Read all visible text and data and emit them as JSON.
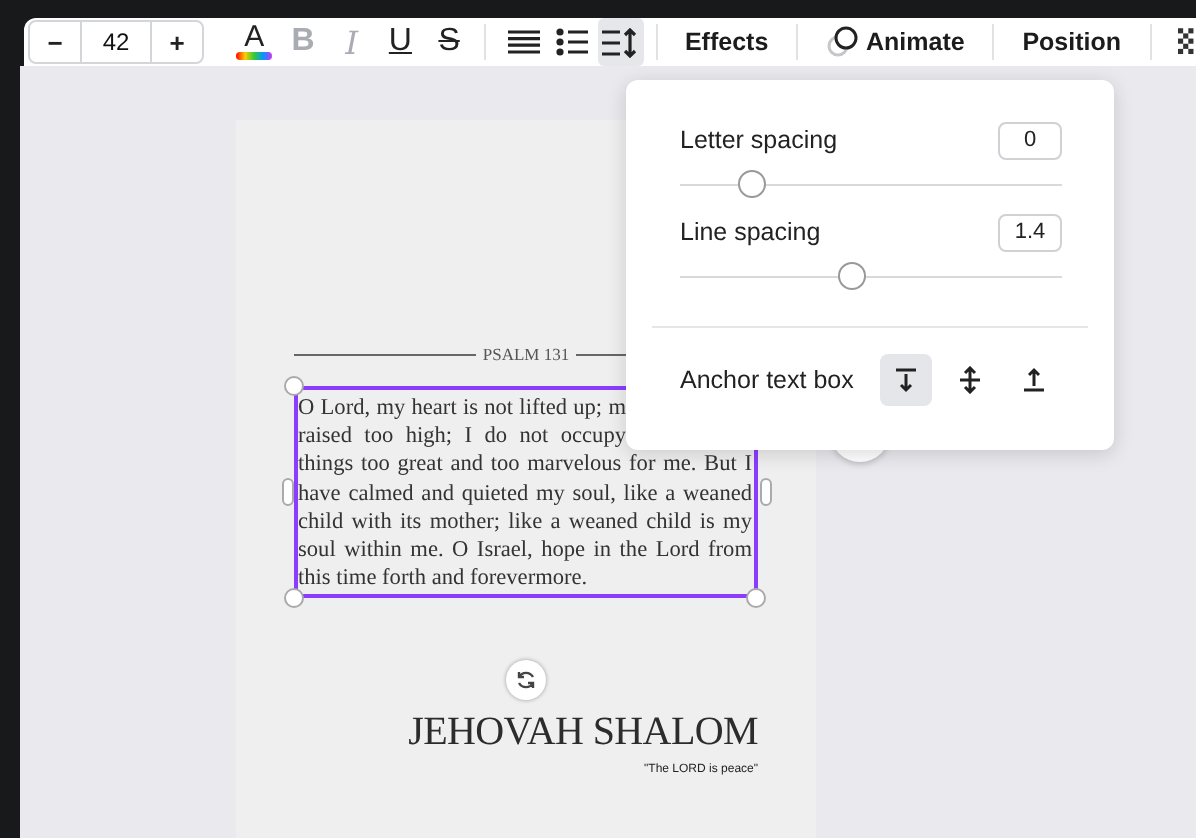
{
  "toolbar": {
    "font_size": {
      "decrease": "−",
      "value": "42",
      "increase": "+"
    },
    "tools": [
      {
        "kind": "color",
        "label": "A",
        "disabled": false,
        "selected": false
      },
      {
        "kind": "bold",
        "label": "B",
        "disabled": true,
        "selected": false
      },
      {
        "kind": "italic",
        "label": "I",
        "disabled": true,
        "selected": false
      },
      {
        "kind": "underline",
        "label": "U",
        "disabled": false,
        "selected": false
      },
      {
        "kind": "strike",
        "label": "S",
        "disabled": false,
        "selected": false
      },
      {
        "kind": "align",
        "disabled": false,
        "selected": false
      },
      {
        "kind": "list",
        "disabled": false,
        "selected": false
      },
      {
        "kind": "spacing",
        "disabled": false,
        "selected": true
      }
    ],
    "buttons": [
      {
        "kind": "text",
        "label": "Effects"
      },
      {
        "kind": "animate",
        "label": "Animate"
      },
      {
        "kind": "text",
        "label": "Position"
      },
      {
        "kind": "transparency"
      }
    ]
  },
  "page": {
    "heading": "PSALM 131",
    "paragraph_lines": [
      {
        "kind": "cut",
        "text": "O Lord, my heart is not lifted up; m"
      },
      {
        "kind": "cut",
        "text": "raised too high; I do not occupy"
      },
      {
        "kind": "full",
        "text": "things too great and too marvelous for me. But I"
      },
      {
        "kind": "full",
        "text": "have calmed and quieted my soul, like a weaned"
      },
      {
        "kind": "full",
        "text": "child with its mother; like a weaned child is my"
      },
      {
        "kind": "full",
        "text": "soul within me. O Israel, hope in the Lord from"
      },
      {
        "kind": "last",
        "text": "this time forth and forevermore."
      }
    ],
    "title": "JEHOVAH SHALOM",
    "subtitle": "\"The LORD is peace\""
  },
  "spacing_popover": {
    "sliders": [
      {
        "label": "Letter spacing",
        "value": "0",
        "level": 0.19
      },
      {
        "label": "Line spacing",
        "value": "1.4",
        "level": 0.45
      }
    ],
    "anchor": {
      "label": "Anchor text box",
      "options": [
        {
          "kind": "top",
          "selected": true
        },
        {
          "kind": "middle",
          "selected": false
        },
        {
          "kind": "bottom",
          "selected": false
        }
      ]
    }
  }
}
